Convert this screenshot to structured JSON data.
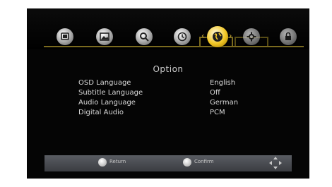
{
  "menu_bar": {
    "icons": [
      {
        "name": "picture-icon"
      },
      {
        "name": "image-icon"
      },
      {
        "name": "search-icon"
      },
      {
        "name": "time-icon"
      },
      {
        "name": "option-globe-icon"
      },
      {
        "name": "settings-gear-icon"
      },
      {
        "name": "lock-icon"
      }
    ],
    "active_index": 4
  },
  "page": {
    "title": "Option"
  },
  "options": [
    {
      "label": "OSD Language",
      "value": "English"
    },
    {
      "label": "Subtitle Language",
      "value": "Off"
    },
    {
      "label": "Audio Language",
      "value": "German"
    },
    {
      "label": "Digital Audio",
      "value": "PCM"
    }
  ],
  "footer": {
    "return_label": "Return",
    "confirm_label": "Confirm"
  },
  "colors": {
    "accent_gold": "#d9b63a",
    "background": "#050505"
  }
}
